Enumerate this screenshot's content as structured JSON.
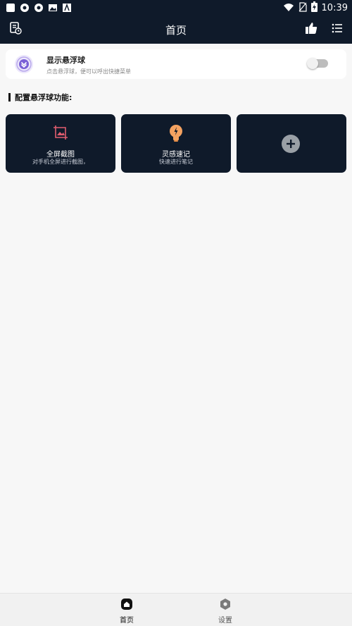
{
  "status_bar": {
    "time": "10:39",
    "icons": [
      "notification-square-icon",
      "sync-icon",
      "sync-icon",
      "image-icon",
      "text-icon",
      "wifi-icon",
      "no-sim-icon",
      "battery-charging-icon"
    ]
  },
  "app_bar": {
    "title": "首页",
    "left_icon": "document-history-icon",
    "right_icons": [
      "thumbs-up-icon",
      "list-menu-icon"
    ]
  },
  "float_ball_card": {
    "title": "显示悬浮球",
    "subtitle": "点击悬浮球，便可以呼出快捷菜单",
    "toggle_on": false
  },
  "section": {
    "title": "配置悬浮球功能:"
  },
  "tiles": [
    {
      "title": "全屏截图",
      "subtitle": "对手机全屏进行截图，",
      "icon": "screenshot-icon"
    },
    {
      "title": "灵感速记",
      "subtitle": "快速进行笔记",
      "icon": "lightbulb-icon"
    },
    {
      "title": "",
      "subtitle": "",
      "icon": "add-icon"
    }
  ],
  "bottom_nav": {
    "items": [
      {
        "label": "首页",
        "icon": "home-icon",
        "active": true
      },
      {
        "label": "设置",
        "icon": "settings-icon",
        "active": false
      }
    ]
  },
  "colors": {
    "dark": "#0f1a2a",
    "accent_purple": "#7b61d6",
    "bulb_orange": "#f4a261",
    "screenshot_red": "#e05d6f"
  }
}
